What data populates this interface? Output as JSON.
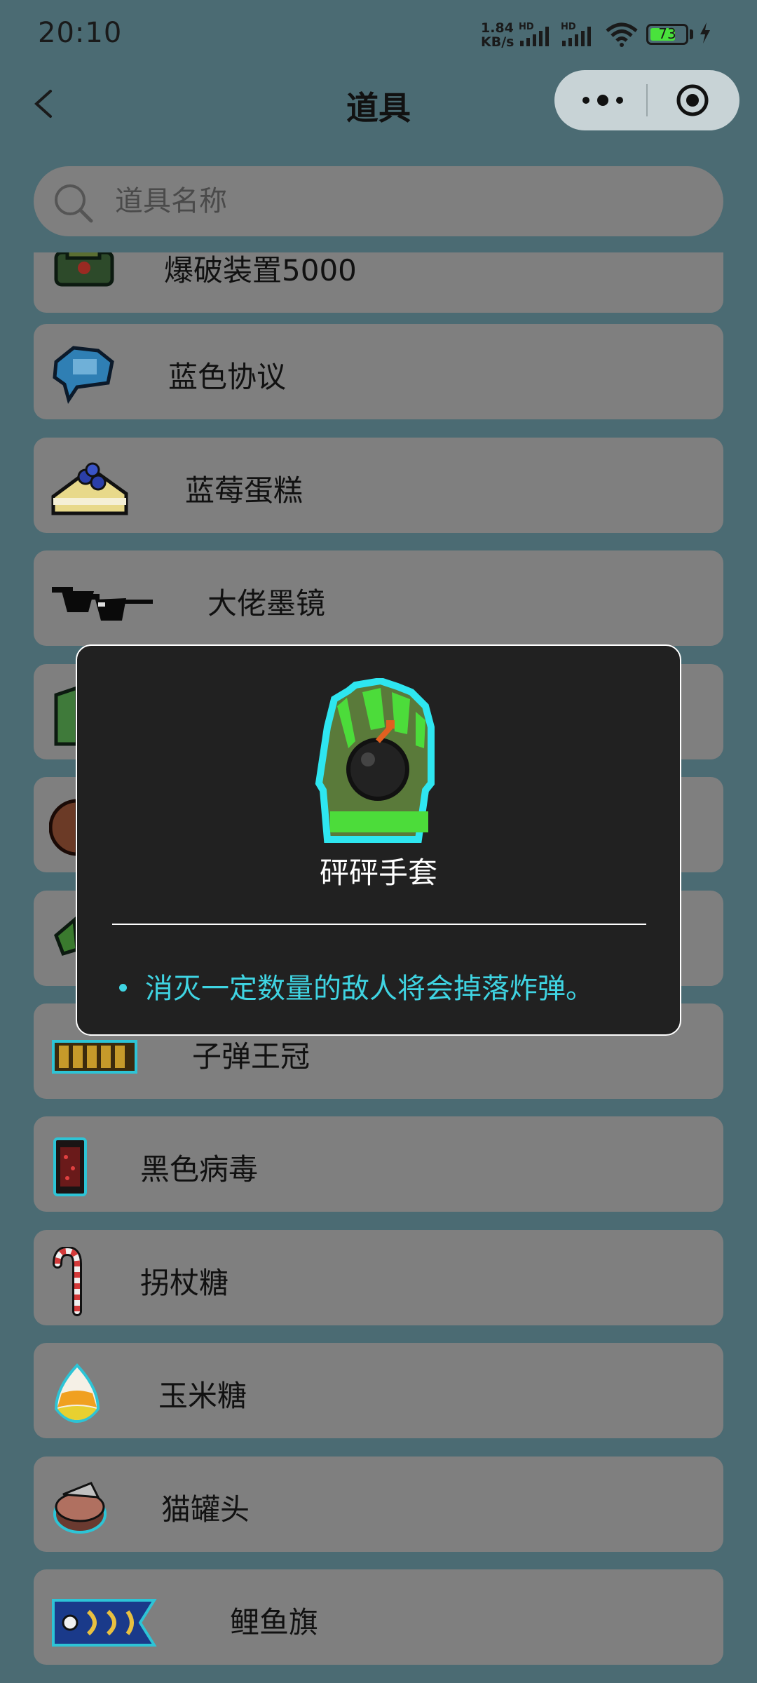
{
  "status_bar": {
    "time": "20:10",
    "net_speed_value": "1.84",
    "net_speed_unit": "KB/s",
    "signal_1_label": "HD",
    "signal_2_label": "HD",
    "battery_level": "73"
  },
  "nav": {
    "title": "道具",
    "back_icon": "chevron-left-icon",
    "more_icon": "more-dots-icon",
    "close_icon": "target-icon"
  },
  "search": {
    "placeholder": "道具名称",
    "value": ""
  },
  "items": [
    {
      "name": "爆破装置5000",
      "icon": "blast-device-icon"
    },
    {
      "name": "蓝色协议",
      "icon": "blue-protocol-icon"
    },
    {
      "name": "蓝莓蛋糕",
      "icon": "blueberry-cake-icon"
    },
    {
      "name": "大佬墨镜",
      "icon": "sunglasses-icon"
    },
    {
      "name": "",
      "icon": "glove-icon"
    },
    {
      "name": "",
      "icon": "brown-round-icon"
    },
    {
      "name": "",
      "icon": "green-leaf-icon"
    },
    {
      "name": "子弹王冠",
      "icon": "bullet-crown-icon"
    },
    {
      "name": "黑色病毒",
      "icon": "black-virus-icon"
    },
    {
      "name": "拐杖糖",
      "icon": "candy-cane-icon"
    },
    {
      "name": "玉米糖",
      "icon": "candy-corn-icon"
    },
    {
      "name": "猫罐头",
      "icon": "cat-food-can-icon"
    },
    {
      "name": "鲤鱼旗",
      "icon": "carp-streamer-icon"
    }
  ],
  "modal": {
    "item_name": "砰砰手套",
    "item_icon": "bomb-glove-icon",
    "description": "消灭一定数量的敌人将会掉落炸弹。",
    "border_color": "#ffffff",
    "text_color": "#3fd4e2"
  },
  "colors": {
    "background": "#4b6b73",
    "card": "#7f7f7f",
    "modal_bg": "#212121",
    "battery_fill": "#49e23c"
  }
}
